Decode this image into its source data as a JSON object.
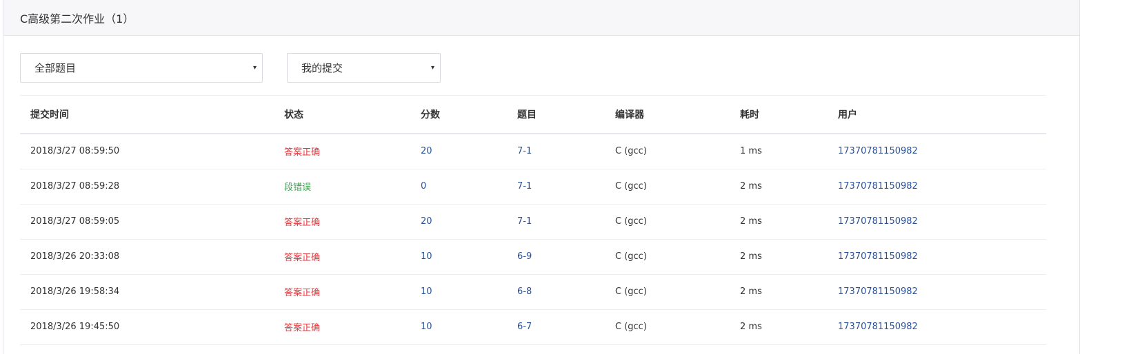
{
  "header": {
    "title": "C高级第二次作业（1）"
  },
  "filters": {
    "problem_select": {
      "value": "全部题目",
      "caret": "▾"
    },
    "scope_select": {
      "value": "我的提交",
      "caret": "▾"
    }
  },
  "table": {
    "columns": [
      "提交时间",
      "状态",
      "分数",
      "题目",
      "编译器",
      "耗时",
      "用户"
    ],
    "rows": [
      {
        "time": "2018/3/27 08:59:50",
        "status": "答案正确",
        "status_type": "ok",
        "score": "20",
        "problem": "7-1",
        "compiler": "C (gcc)",
        "elapsed": "1 ms",
        "user": "17370781150982"
      },
      {
        "time": "2018/3/27 08:59:28",
        "status": "段错误",
        "status_type": "seg",
        "score": "0",
        "problem": "7-1",
        "compiler": "C (gcc)",
        "elapsed": "2 ms",
        "user": "17370781150982"
      },
      {
        "time": "2018/3/27 08:59:05",
        "status": "答案正确",
        "status_type": "ok",
        "score": "20",
        "problem": "7-1",
        "compiler": "C (gcc)",
        "elapsed": "2 ms",
        "user": "17370781150982"
      },
      {
        "time": "2018/3/26 20:33:08",
        "status": "答案正确",
        "status_type": "ok",
        "score": "10",
        "problem": "6-9",
        "compiler": "C (gcc)",
        "elapsed": "2 ms",
        "user": "17370781150982"
      },
      {
        "time": "2018/3/26 19:58:34",
        "status": "答案正确",
        "status_type": "ok",
        "score": "10",
        "problem": "6-8",
        "compiler": "C (gcc)",
        "elapsed": "2 ms",
        "user": "17370781150982"
      },
      {
        "time": "2018/3/26 19:45:50",
        "status": "答案正确",
        "status_type": "ok",
        "score": "10",
        "problem": "6-7",
        "compiler": "C (gcc)",
        "elapsed": "2 ms",
        "user": "17370781150982"
      }
    ]
  },
  "colors": {
    "status_ok": "#e0393e",
    "status_seg": "#3aa64b",
    "link": "#2a5298",
    "header_bg": "#f7f7f9"
  }
}
